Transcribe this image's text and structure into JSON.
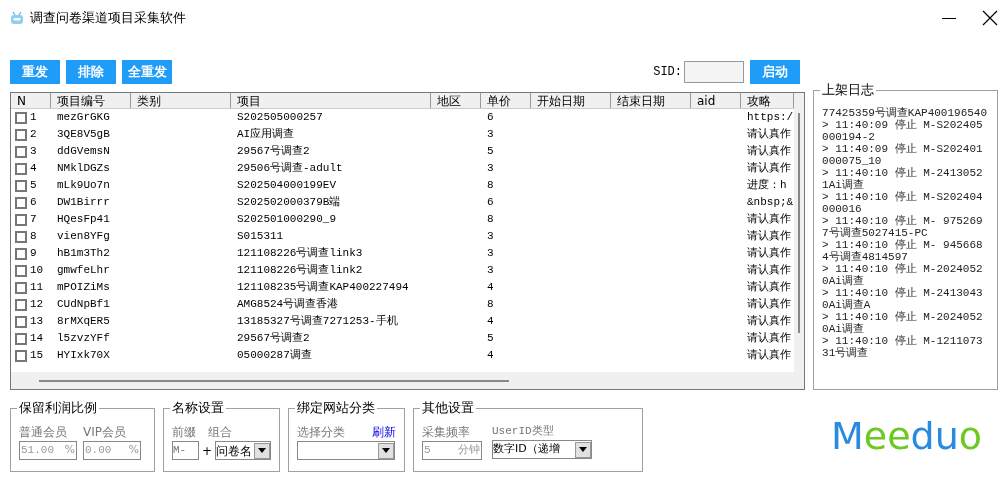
{
  "window": {
    "title": "调查问卷渠道项目采集软件"
  },
  "toolbar": {
    "buttons": [
      "重发",
      "排除",
      "全重发"
    ],
    "sid_label": "SID:",
    "start_button": "启动"
  },
  "table": {
    "columns": [
      "N",
      "项目编号",
      "类别",
      "项目",
      "地区",
      "单价",
      "开始日期",
      "结束日期",
      "aid",
      "攻略"
    ],
    "rows": [
      {
        "checked": false,
        "n": "1",
        "code": "mezGrGKG",
        "item": "S202505000257",
        "price": "6",
        "guide": "https:/"
      },
      {
        "checked": false,
        "n": "2",
        "code": "3QE8V5gB",
        "item": "AI应用调查",
        "price": "3",
        "guide": "请认真作"
      },
      {
        "checked": false,
        "n": "3",
        "code": "ddGVemsN",
        "item": "29567号调查2",
        "price": "5",
        "guide": "请认真作"
      },
      {
        "checked": false,
        "n": "4",
        "code": "NMklDGZs",
        "item": "29506号调查-adult",
        "price": "3",
        "guide": "请认真作"
      },
      {
        "checked": false,
        "n": "5",
        "code": "mLk9Uo7n",
        "item": "S202504000199EV",
        "price": "8",
        "guide": "进度：h"
      },
      {
        "checked": false,
        "n": "6",
        "code": "DW1Birrr",
        "item": "S202502000379B端",
        "price": "6",
        "guide": "&nbsp;&"
      },
      {
        "checked": false,
        "n": "7",
        "code": "HQesFp41",
        "item": "S202501000290_9",
        "price": "8",
        "guide": "请认真作"
      },
      {
        "checked": false,
        "n": "8",
        "code": "vien8YFg",
        "item": "S015311",
        "price": "3",
        "guide": "请认真作"
      },
      {
        "checked": false,
        "n": "9",
        "code": "hB1m3Th2",
        "item": "121108226号调查link3",
        "price": "3",
        "guide": "请认真作"
      },
      {
        "checked": false,
        "n": "10",
        "code": "gmwfeLhr",
        "item": "121108226号调查link2",
        "price": "3",
        "guide": "请认真作"
      },
      {
        "checked": false,
        "n": "11",
        "code": "mPOIZiMs",
        "item": "121108235号调查KAP400227494",
        "price": "4",
        "guide": "请认真作"
      },
      {
        "checked": false,
        "n": "12",
        "code": "CUdNpBf1",
        "item": "AMG8524号调查香港",
        "price": "8",
        "guide": "请认真作"
      },
      {
        "checked": false,
        "n": "13",
        "code": "8rMXqER5",
        "item": "13185327号调查7271253-手机",
        "price": "4",
        "guide": "请认真作"
      },
      {
        "checked": false,
        "n": "14",
        "code": "l5zvzYFf",
        "item": "29567号调查2",
        "price": "5",
        "guide": "请认真作"
      },
      {
        "checked": false,
        "n": "15",
        "code": "HYIxk70X",
        "item": "05000287调查",
        "price": "4",
        "guide": "请认真作"
      }
    ]
  },
  "log": {
    "title": "上架日志",
    "entries": [
      "77425359号调查KAP400196540",
      "> 11:40:09 停止 M-S202405000194-2",
      "> 11:40:09 停止 M-S202401000075_10",
      "> 11:40:10 停止 M-24130521Ai调查",
      "> 11:40:10 停止 M-S202404000016",
      "> 11:40:10 停止 M- 9752697号调查5027415-PC",
      "> 11:40:10 停止 M- 9456684号调查4814597",
      "> 11:40:10 停止 M-20240520Ai调查",
      "> 11:40:10 停止 M-24130430Ai调查A",
      "> 11:40:10 停止 M-20240520Ai调查",
      "> 11:40:10 停止 M-121107331号调查"
    ]
  },
  "profit": {
    "title": "保留利润比例",
    "fields": [
      {
        "label": "普通会员",
        "value": "51.00",
        "unit": "%"
      },
      {
        "label": "VIP会员",
        "value": "0.00",
        "unit": "%"
      }
    ]
  },
  "naming": {
    "title": "名称设置",
    "prefix_label": "前缀",
    "prefix": "M-",
    "plus": "+",
    "combo_label": "组合",
    "combo": "问卷名"
  },
  "category": {
    "title": "绑定网站分类",
    "label": "选择分类",
    "refresh_link": "刷新"
  },
  "other": {
    "title": "其他设置",
    "freq_label": "采集频率",
    "freq": "5",
    "freq_unit": "分钟",
    "uid_label": "UserID类型",
    "uid_type": "数字ID（递增"
  },
  "logo": {
    "letters": [
      {
        "text": "M",
        "color": "#2a8ae0"
      },
      {
        "text": "e",
        "color": "#6cc91f"
      },
      {
        "text": "e",
        "color": "#6cc91f"
      },
      {
        "text": "d",
        "color": "#2a8ae0"
      },
      {
        "text": "u",
        "color": "#2a8ae0"
      },
      {
        "text": "o",
        "color": "#6cc91f"
      }
    ]
  }
}
